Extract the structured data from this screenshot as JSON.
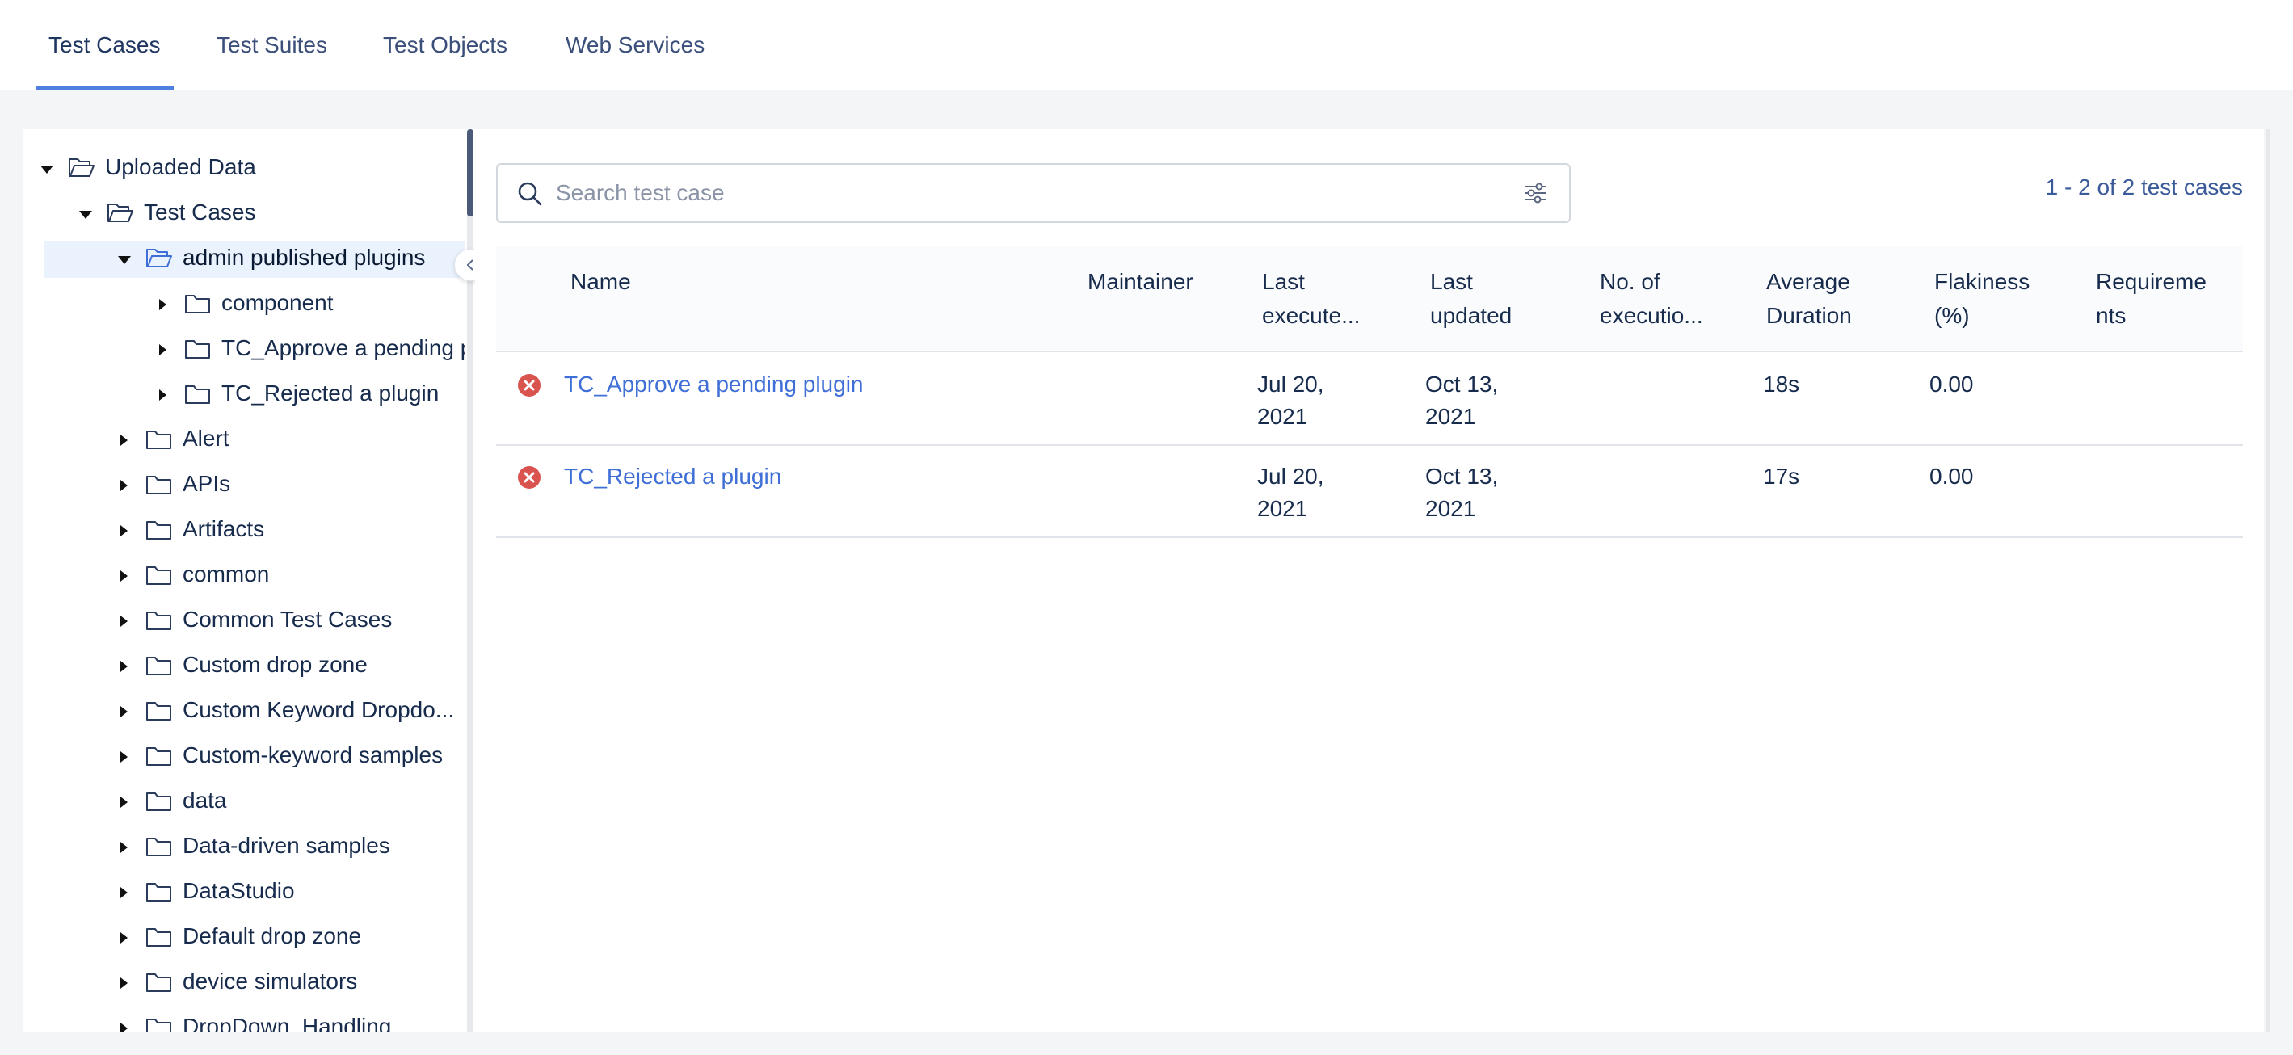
{
  "tabs": [
    {
      "label": "Test Cases",
      "active": true
    },
    {
      "label": "Test Suites",
      "active": false
    },
    {
      "label": "Test Objects",
      "active": false
    },
    {
      "label": "Web Services",
      "active": false
    }
  ],
  "tree": {
    "root": "Uploaded Data",
    "level1": "Test Cases",
    "selected": "admin published plugins",
    "children": [
      "component",
      "TC_Approve a pending plugin",
      "TC_Rejected a plugin"
    ],
    "folders": [
      "Alert",
      "APIs",
      "Artifacts",
      "common",
      "Common Test Cases",
      "Custom drop zone",
      "Custom Keyword Dropdo...",
      "Custom-keyword samples",
      "data",
      "Data-driven samples",
      "DataStudio",
      "Default drop zone",
      "device simulators",
      "DropDown_Handling"
    ]
  },
  "search": {
    "placeholder": "Search test case",
    "value": ""
  },
  "count_label": "1 - 2 of 2 test cases",
  "table": {
    "headers": {
      "name": "Name",
      "maintainer": "Maintainer",
      "last_executed": [
        "Last",
        "execute..."
      ],
      "last_updated": [
        "Last",
        "updated"
      ],
      "executions": [
        "No. of",
        "executio..."
      ],
      "duration": [
        "Average",
        "Duration"
      ],
      "flakiness": [
        "Flakiness",
        "(%)"
      ],
      "requirements": [
        "Requireme",
        "nts"
      ]
    },
    "rows": [
      {
        "status": "failed",
        "name": "TC_Approve a pending plugin",
        "maintainer": "",
        "last_executed": [
          "Jul 20,",
          "2021"
        ],
        "last_updated": [
          "Oct 13,",
          "2021"
        ],
        "executions": "",
        "duration": "18s",
        "flakiness": "0.00",
        "requirements": ""
      },
      {
        "status": "failed",
        "name": "TC_Rejected a plugin",
        "maintainer": "",
        "last_executed": [
          "Jul 20,",
          "2021"
        ],
        "last_updated": [
          "Oct 13,",
          "2021"
        ],
        "executions": "",
        "duration": "17s",
        "flakiness": "0.00",
        "requirements": ""
      }
    ]
  },
  "colors": {
    "accent": "#4c7fe0",
    "link": "#3f6fd6",
    "error": "#d9534f",
    "selected_bg": "#e9f2fd"
  }
}
